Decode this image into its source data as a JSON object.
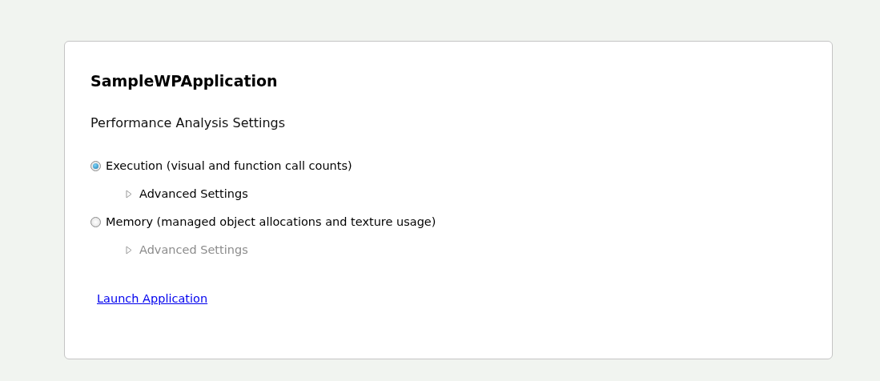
{
  "title": "SampleWPApplication",
  "subtitle": "Performance Analysis Settings",
  "options": [
    {
      "label": "Execution (visual and function call counts)",
      "selected": true,
      "advanced": {
        "label": "Advanced Settings",
        "expanded": false,
        "disabled": false
      }
    },
    {
      "label": "Memory (managed object allocations and texture usage)",
      "selected": false,
      "advanced": {
        "label": "Advanced Settings",
        "expanded": false,
        "disabled": true
      }
    }
  ],
  "link": "Launch Application"
}
